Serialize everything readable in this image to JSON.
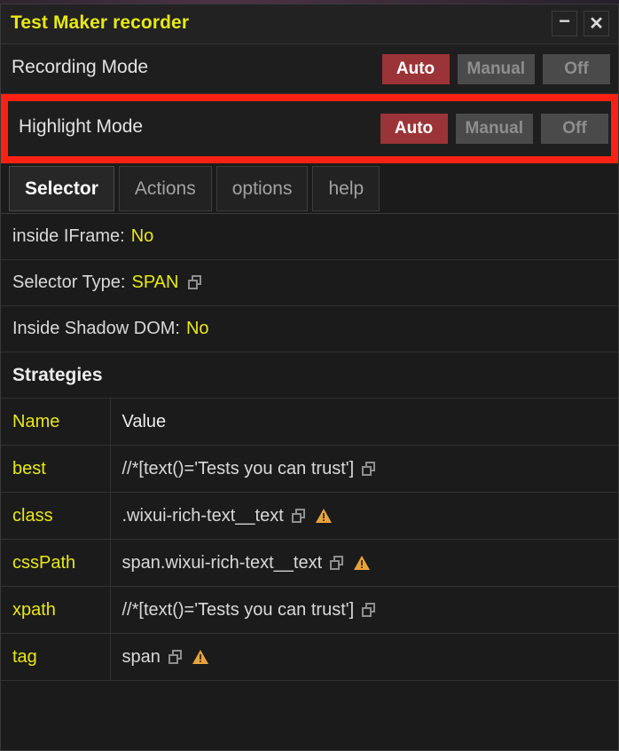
{
  "window": {
    "title": "Test Maker recorder",
    "minimize_label": "−",
    "close_label": "✕",
    "title_color": "#e8e815"
  },
  "modes": [
    {
      "label": "Recording Mode",
      "options": [
        "Auto",
        "Manual",
        "Off"
      ],
      "selected": "Auto",
      "highlighted": false
    },
    {
      "label": "Highlight Mode",
      "options": [
        "Auto",
        "Manual",
        "Off"
      ],
      "selected": "Auto",
      "highlighted": true,
      "highlight_color": "#fc2113"
    }
  ],
  "tabs": [
    {
      "label": "Selector",
      "active": true
    },
    {
      "label": "Actions",
      "active": false
    },
    {
      "label": "options",
      "active": false
    },
    {
      "label": "help",
      "active": false
    }
  ],
  "info": [
    {
      "label": "inside IFrame:",
      "value": "No",
      "copy": false
    },
    {
      "label": "Selector Type:",
      "value": "SPAN",
      "copy": true
    },
    {
      "label": "Inside Shadow DOM:",
      "value": "No",
      "copy": false
    }
  ],
  "strategies": {
    "heading": "Strategies",
    "columns": [
      "Name",
      "Value"
    ],
    "rows": [
      {
        "name": "best",
        "value": "//*[text()='Tests you can trust']",
        "copy": true,
        "warning": false
      },
      {
        "name": "class",
        "value": ".wixui-rich-text__text",
        "copy": true,
        "warning": true
      },
      {
        "name": "cssPath",
        "value": "span.wixui-rich-text__text",
        "copy": true,
        "warning": true
      },
      {
        "name": "xpath",
        "value": "//*[text()='Tests you can trust']",
        "copy": true,
        "warning": false
      },
      {
        "name": "tag",
        "value": "span",
        "copy": true,
        "warning": true
      }
    ]
  },
  "colors": {
    "accent_yellow": "#e8e815",
    "active_red": "#9b3438",
    "highlight_red": "#fc2113",
    "warning_amber": "#e8a33d",
    "panel_bg": "#1b1b1b"
  }
}
